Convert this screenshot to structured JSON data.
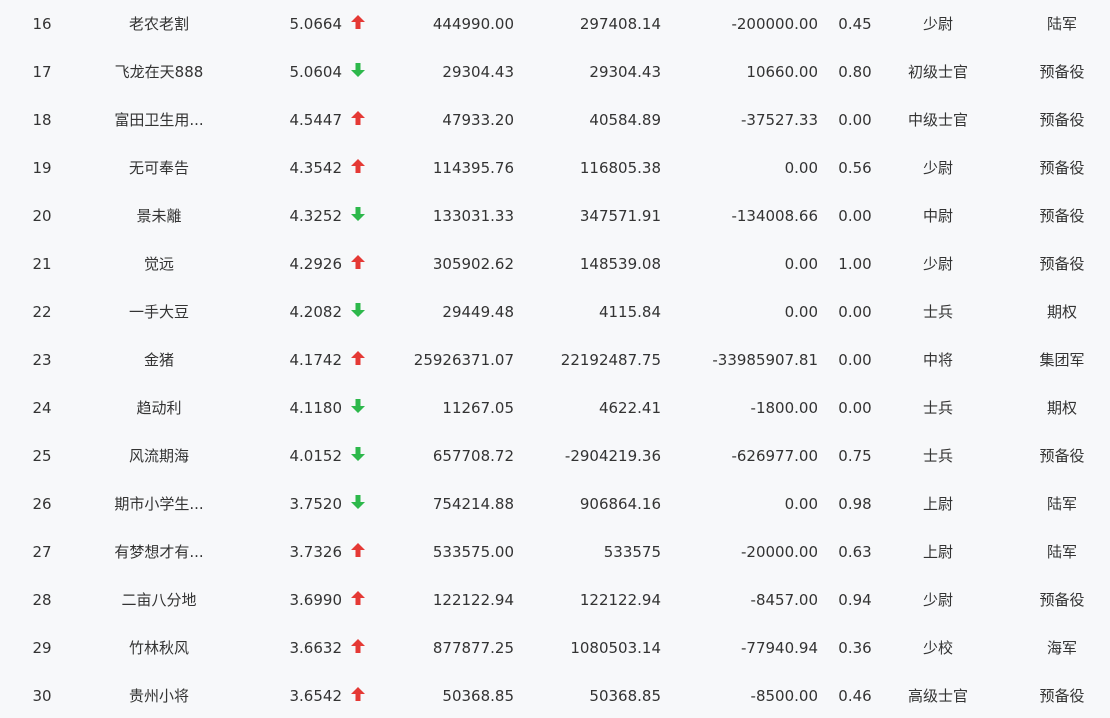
{
  "colors": {
    "up": "#e53935",
    "down": "#2db84b",
    "text": "#333333",
    "background": "#f7f8fa"
  },
  "rows": [
    {
      "rank": "16",
      "name": "老农老割",
      "score": "5.0664",
      "trend": "up",
      "value1": "444990.00",
      "value2": "297408.14",
      "value3": "-200000.00",
      "ratio": "0.45",
      "grade": "少尉",
      "category": "陆军"
    },
    {
      "rank": "17",
      "name": "飞龙在天888",
      "score": "5.0604",
      "trend": "down",
      "value1": "29304.43",
      "value2": "29304.43",
      "value3": "10660.00",
      "ratio": "0.80",
      "grade": "初级士官",
      "category": "预备役"
    },
    {
      "rank": "18",
      "name": "富田卫生用...",
      "score": "4.5447",
      "trend": "up",
      "value1": "47933.20",
      "value2": "40584.89",
      "value3": "-37527.33",
      "ratio": "0.00",
      "grade": "中级士官",
      "category": "预备役"
    },
    {
      "rank": "19",
      "name": "无可奉告",
      "score": "4.3542",
      "trend": "up",
      "value1": "114395.76",
      "value2": "116805.38",
      "value3": "0.00",
      "ratio": "0.56",
      "grade": "少尉",
      "category": "预备役"
    },
    {
      "rank": "20",
      "name": "景未離",
      "score": "4.3252",
      "trend": "down",
      "value1": "133031.33",
      "value2": "347571.91",
      "value3": "-134008.66",
      "ratio": "0.00",
      "grade": "中尉",
      "category": "预备役"
    },
    {
      "rank": "21",
      "name": "觉远",
      "score": "4.2926",
      "trend": "up",
      "value1": "305902.62",
      "value2": "148539.08",
      "value3": "0.00",
      "ratio": "1.00",
      "grade": "少尉",
      "category": "预备役"
    },
    {
      "rank": "22",
      "name": "一手大豆",
      "score": "4.2082",
      "trend": "down",
      "value1": "29449.48",
      "value2": "4115.84",
      "value3": "0.00",
      "ratio": "0.00",
      "grade": "士兵",
      "category": "期权"
    },
    {
      "rank": "23",
      "name": "金猪",
      "score": "4.1742",
      "trend": "up",
      "value1": "25926371.07",
      "value2": "22192487.75",
      "value3": "-33985907.81",
      "ratio": "0.00",
      "grade": "中将",
      "category": "集团军"
    },
    {
      "rank": "24",
      "name": "趋动利",
      "score": "4.1180",
      "trend": "down",
      "value1": "11267.05",
      "value2": "4622.41",
      "value3": "-1800.00",
      "ratio": "0.00",
      "grade": "士兵",
      "category": "期权"
    },
    {
      "rank": "25",
      "name": "风流期海",
      "score": "4.0152",
      "trend": "down",
      "value1": "657708.72",
      "value2": "-2904219.36",
      "value3": "-626977.00",
      "ratio": "0.75",
      "grade": "士兵",
      "category": "预备役"
    },
    {
      "rank": "26",
      "name": "期市小学生...",
      "score": "3.7520",
      "trend": "down",
      "value1": "754214.88",
      "value2": "906864.16",
      "value3": "0.00",
      "ratio": "0.98",
      "grade": "上尉",
      "category": "陆军"
    },
    {
      "rank": "27",
      "name": "有梦想才有...",
      "score": "3.7326",
      "trend": "up",
      "value1": "533575.00",
      "value2": "533575",
      "value3": "-20000.00",
      "ratio": "0.63",
      "grade": "上尉",
      "category": "陆军"
    },
    {
      "rank": "28",
      "name": "二亩八分地",
      "score": "3.6990",
      "trend": "up",
      "value1": "122122.94",
      "value2": "122122.94",
      "value3": "-8457.00",
      "ratio": "0.94",
      "grade": "少尉",
      "category": "预备役"
    },
    {
      "rank": "29",
      "name": "竹林秋风",
      "score": "3.6632",
      "trend": "up",
      "value1": "877877.25",
      "value2": "1080503.14",
      "value3": "-77940.94",
      "ratio": "0.36",
      "grade": "少校",
      "category": "海军"
    },
    {
      "rank": "30",
      "name": "贵州小将",
      "score": "3.6542",
      "trend": "up",
      "value1": "50368.85",
      "value2": "50368.85",
      "value3": "-8500.00",
      "ratio": "0.46",
      "grade": "高级士官",
      "category": "预备役"
    }
  ]
}
